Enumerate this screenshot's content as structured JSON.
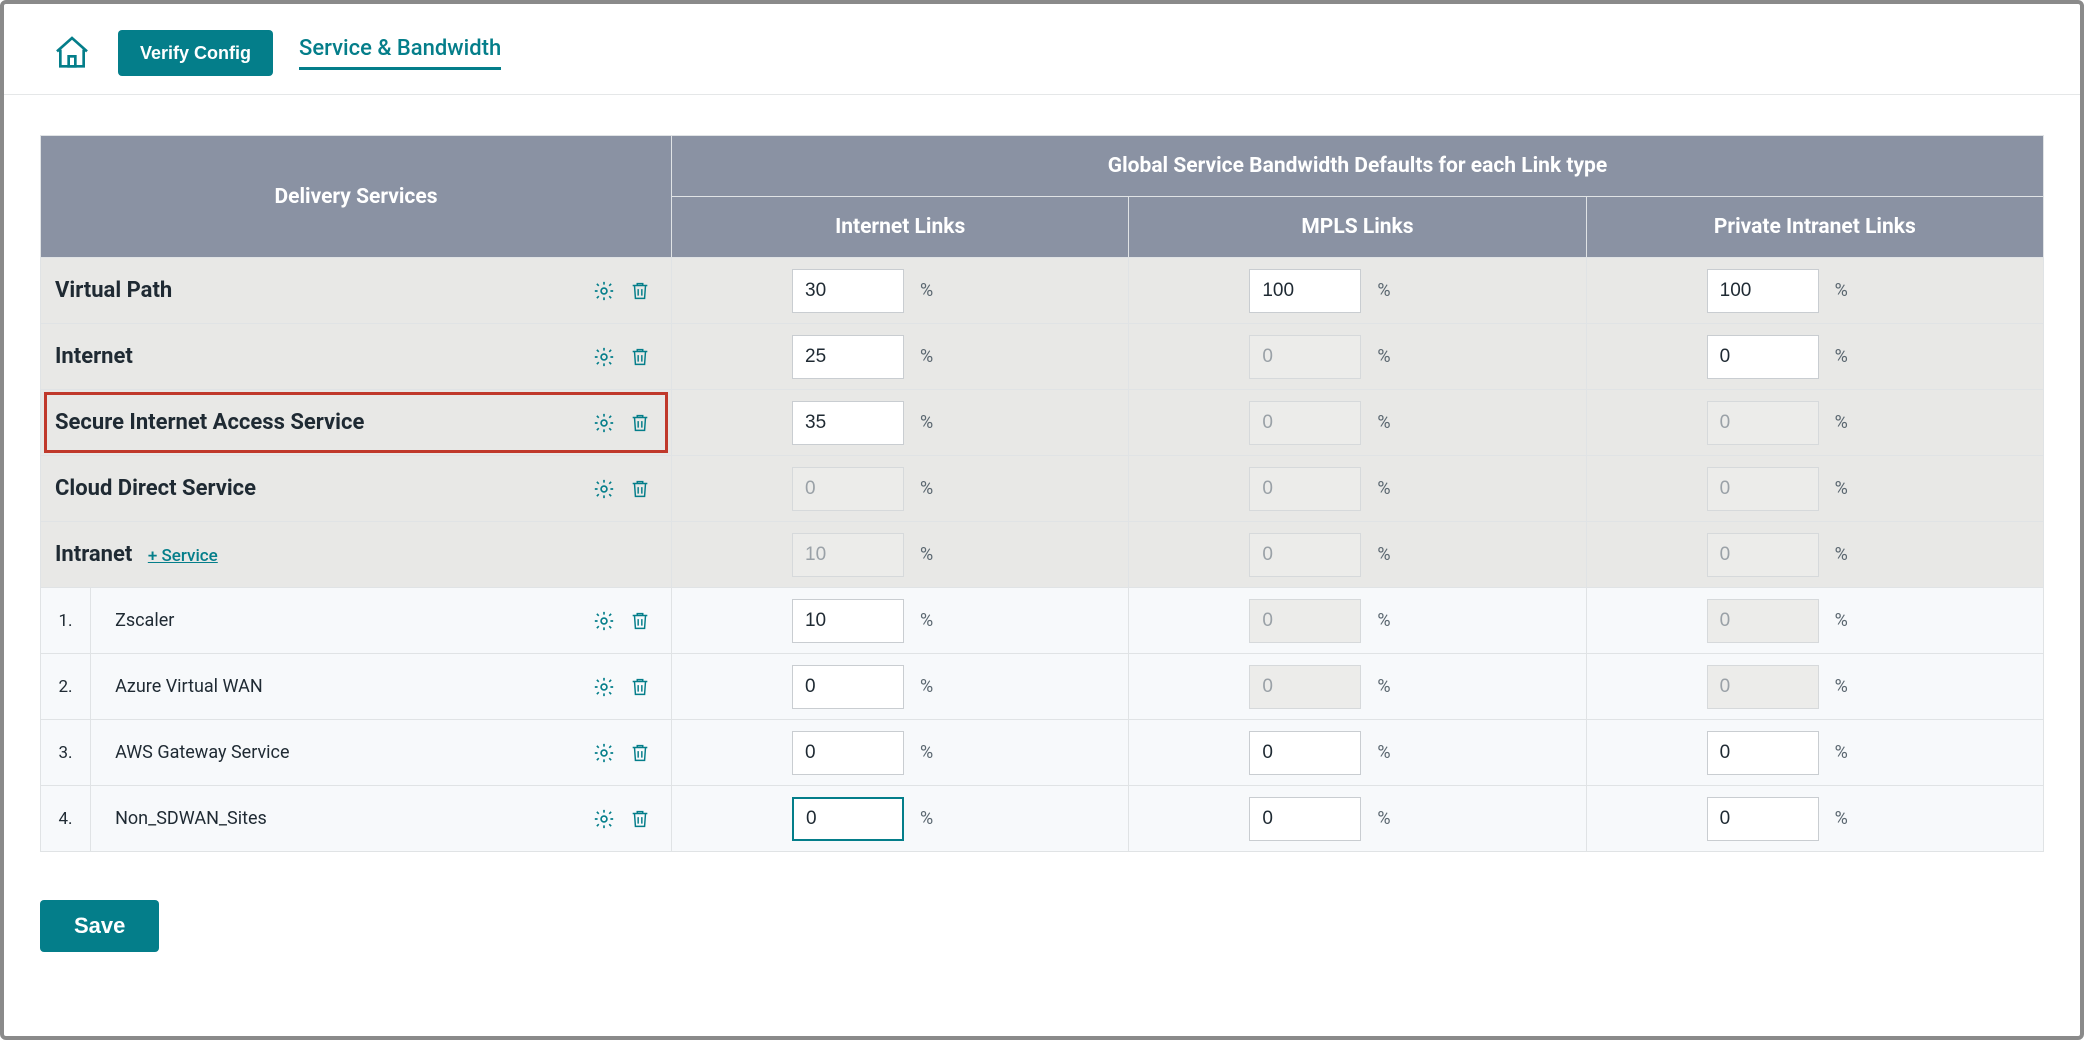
{
  "header": {
    "verify_label": "Verify Config",
    "tab_label": "Service & Bandwidth"
  },
  "table": {
    "header_delivery": "Delivery Services",
    "header_global": "Global Service Bandwidth Defaults for each Link type",
    "col_internet": "Internet Links",
    "col_mpls": "MPLS Links",
    "col_private": "Private Intranet Links",
    "pct": "%",
    "add_service": "+ Service",
    "rows": {
      "vpath": {
        "label": "Virtual Path",
        "internet": "30",
        "mpls": "100",
        "private": "100"
      },
      "inet": {
        "label": "Internet",
        "internet": "25",
        "mpls": "0",
        "private": "0"
      },
      "sias": {
        "label": "Secure Internet Access Service",
        "internet": "35",
        "mpls": "0",
        "private": "0"
      },
      "cds": {
        "label": "Cloud Direct Service",
        "internet": "0",
        "mpls": "0",
        "private": "0"
      },
      "intra": {
        "label": "Intranet",
        "internet": "10",
        "mpls": "0",
        "private": "0"
      },
      "sub1": {
        "idx": "1.",
        "label": "Zscaler",
        "internet": "10",
        "mpls": "0",
        "private": "0"
      },
      "sub2": {
        "idx": "2.",
        "label": "Azure Virtual WAN",
        "internet": "0",
        "mpls": "0",
        "private": "0"
      },
      "sub3": {
        "idx": "3.",
        "label": "AWS Gateway Service",
        "internet": "0",
        "mpls": "0",
        "private": "0"
      },
      "sub4": {
        "idx": "4.",
        "label": "Non_SDWAN_Sites",
        "internet": "0",
        "mpls": "0",
        "private": "0"
      }
    }
  },
  "save_label": "Save"
}
